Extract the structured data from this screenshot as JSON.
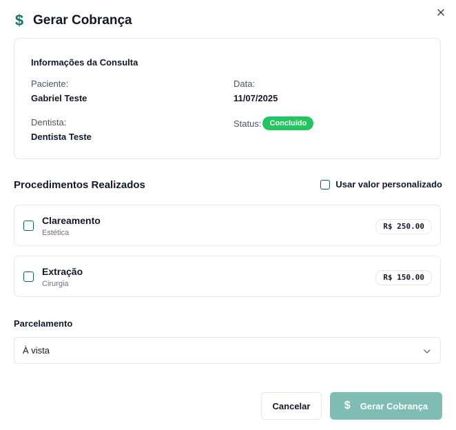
{
  "dialog": {
    "title": "Gerar Cobrança",
    "title_icon": "dollar-icon",
    "close_icon": "close-icon"
  },
  "consulta": {
    "heading": "Informações da Consulta",
    "paciente_label": "Paciente:",
    "paciente_value": "Gabriel Teste",
    "data_label": "Data:",
    "data_value": "11/07/2025",
    "dentista_label": "Dentista:",
    "dentista_value": "Dentista Teste",
    "status_label": "Status:",
    "status_value": "Concluído",
    "status_color": "#22c55e"
  },
  "procedimentos": {
    "heading": "Procedimentos Realizados",
    "custom_value_label": "Usar valor personalizado",
    "custom_value_checked": false,
    "items": [
      {
        "name": "Clareamento",
        "category": "Estética",
        "price": "R$ 250.00",
        "checked": false
      },
      {
        "name": "Extração",
        "category": "Cirurgia",
        "price": "R$ 150.00",
        "checked": false
      }
    ]
  },
  "parcelamento": {
    "label": "Parcelamento",
    "selected": "À vista"
  },
  "actions": {
    "cancel_label": "Cancelar",
    "submit_label": "Gerar Cobrança",
    "submit_icon": "dollar-icon"
  },
  "colors": {
    "accent": "#0f766e",
    "primary_button": "#7fbcb4",
    "border": "#e5e7eb"
  }
}
